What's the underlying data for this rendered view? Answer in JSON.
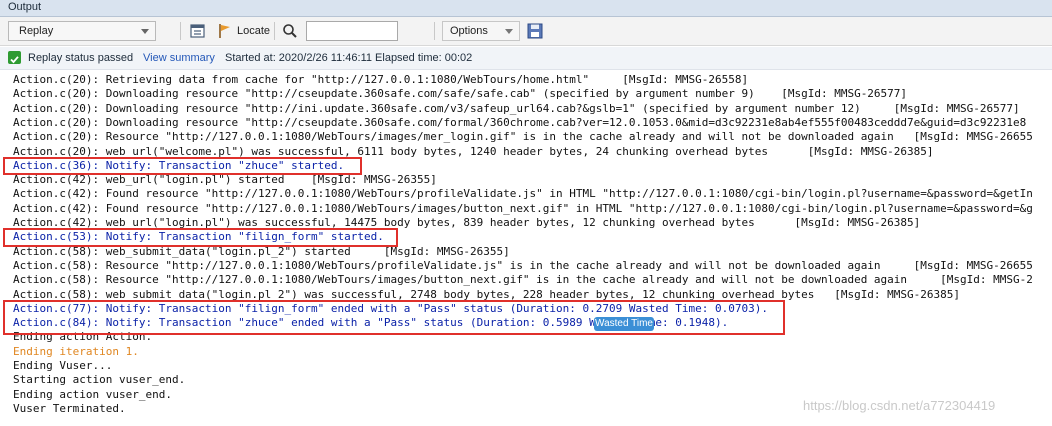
{
  "panel": {
    "title": "Output"
  },
  "toolbar": {
    "mode_select": "Replay",
    "locate_label": "Locate",
    "search_value": "",
    "options_label": "Options"
  },
  "status": {
    "passed": "Replay status passed",
    "view_summary": "View summary",
    "started": "Started at: 2020/2/26 11:46:11 Elapsed time: 00:02"
  },
  "log_lines": [
    {
      "text": "Action.c(20): Retrieving data from cache for \"http://127.0.0.1:1080/WebTours/home.html\"     [MsgId: MMSG-26558]",
      "color": "default"
    },
    {
      "text": "Action.c(20): Downloading resource \"http://cseupdate.360safe.com/safe/safe.cab\" (specified by argument number 9)    [MsgId: MMSG-26577]",
      "color": "default"
    },
    {
      "text": "Action.c(20): Downloading resource \"http://ini.update.360safe.com/v3/safeup_url64.cab?&gslb=1\" (specified by argument number 12)     [MsgId: MMSG-26577]",
      "color": "default"
    },
    {
      "text": "Action.c(20): Downloading resource \"http://cseupdate.360safe.com/formal/360chrome.cab?ver=12.0.1053.0&mid=d3c92231e8ab4ef555f00483ceddd7e&guid=d3c92231e8",
      "color": "default"
    },
    {
      "text": "Action.c(20): Resource \"http://127.0.0.1:1080/WebTours/images/mer_login.gif\" is in the cache already and will not be downloaded again   [MsgId: MMSG-26655",
      "color": "default"
    },
    {
      "text": "Action.c(20): web_url(\"welcome.pl\") was successful, 6111 body bytes, 1240 header bytes, 24 chunking overhead bytes      [MsgId: MMSG-26385]",
      "color": "default"
    },
    {
      "text": "Action.c(36): Notify: Transaction \"zhuce\" started.",
      "color": "blue"
    },
    {
      "text": "Action.c(42): web_url(\"login.pl\") started    [MsgId: MMSG-26355]",
      "color": "default"
    },
    {
      "text": "Action.c(42): Found resource \"http://127.0.0.1:1080/WebTours/profileValidate.js\" in HTML \"http://127.0.0.1:1080/cgi-bin/login.pl?username=&password=&getIn",
      "color": "default"
    },
    {
      "text": "Action.c(42): Found resource \"http://127.0.0.1:1080/WebTours/images/button_next.gif\" in HTML \"http://127.0.0.1:1080/cgi-bin/login.pl?username=&password=&g",
      "color": "default"
    },
    {
      "text": "Action.c(42): web_url(\"login.pl\") was successful, 14475 body bytes, 839 header bytes, 12 chunking overhead bytes      [MsgId: MMSG-26385]",
      "color": "default"
    },
    {
      "text": "Action.c(53): Notify: Transaction \"filign_form\" started.",
      "color": "blue"
    },
    {
      "text": "Action.c(58): web_submit_data(\"login.pl_2\") started     [MsgId: MMSG-26355]",
      "color": "default"
    },
    {
      "text": "Action.c(58): Resource \"http://127.0.0.1:1080/WebTours/profileValidate.js\" is in the cache already and will not be downloaded again     [MsgId: MMSG-26655",
      "color": "default"
    },
    {
      "text": "Action.c(58): Resource \"http://127.0.0.1:1080/WebTours/images/button_next.gif\" is in the cache already and will not be downloaded again     [MsgId: MMSG-2",
      "color": "default"
    },
    {
      "text": "Action.c(58): web_submit_data(\"login.pl_2\") was successful, 2748 body bytes, 228 header bytes, 12 chunking overhead bytes   [MsgId: MMSG-26385]",
      "color": "default"
    },
    {
      "text": "Action.c(77): Notify: Transaction \"filign_form\" ended with a \"Pass\" status (Duration: 0.2709 Wasted Time: 0.0703).",
      "color": "blue"
    },
    {
      "text": "Action.c(84): Notify: Transaction \"zhuce\" ended with a \"Pass\" status (Duration: 0.5989 Wasted Time: 0.1948).",
      "color": "blue"
    },
    {
      "text": "Ending action Action.",
      "color": "default"
    },
    {
      "text": "Ending iteration 1.",
      "color": "orange"
    },
    {
      "text": "Ending Vuser...",
      "color": "default"
    },
    {
      "text": "Starting action vuser_end.",
      "color": "default"
    },
    {
      "text": "Ending action vuser_end.",
      "color": "default"
    },
    {
      "text": "Vuser Terminated.",
      "color": "default"
    }
  ],
  "tooltip": "Wasted Time",
  "watermark": "https://blog.csdn.net/a772304419",
  "colors": {
    "notify_text": "#0b22a8",
    "iteration_text": "#e08722",
    "highlight_box": "#e0302b",
    "status_pass": "#2e9b32"
  }
}
